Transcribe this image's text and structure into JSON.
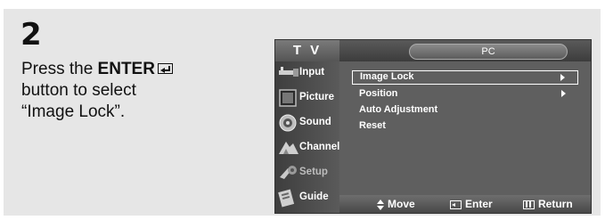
{
  "step": {
    "number": "2"
  },
  "instruction": {
    "line1_prefix": "Press the ",
    "line1_bold": "ENTER",
    "line1_icon": "enter-icon",
    "line2": "button to select",
    "line3": "“Image Lock”."
  },
  "tv": {
    "header_title": "T V",
    "pill_label": "PC",
    "sidebar": [
      {
        "label": "Input",
        "icon": "input-icon",
        "dim": false
      },
      {
        "label": "Picture",
        "icon": "picture-icon",
        "dim": false
      },
      {
        "label": "Sound",
        "icon": "sound-icon",
        "dim": false
      },
      {
        "label": "Channel",
        "icon": "channel-icon",
        "dim": false
      },
      {
        "label": "Setup",
        "icon": "setup-icon",
        "dim": true
      },
      {
        "label": "Guide",
        "icon": "guide-icon",
        "dim": false
      }
    ],
    "menu": [
      {
        "label": "Image Lock",
        "arrow": true,
        "selected": true
      },
      {
        "label": "Position",
        "arrow": true,
        "selected": false
      },
      {
        "label": "Auto Adjustment",
        "arrow": false,
        "selected": false
      },
      {
        "label": "Reset",
        "arrow": false,
        "selected": false
      }
    ],
    "footer": {
      "move": "Move",
      "enter": "Enter",
      "return": "Return"
    }
  },
  "colors": {
    "panel_bg": "#e6e6e6",
    "osd_body": "#5f5f5f",
    "osd_text": "#ffffff"
  }
}
